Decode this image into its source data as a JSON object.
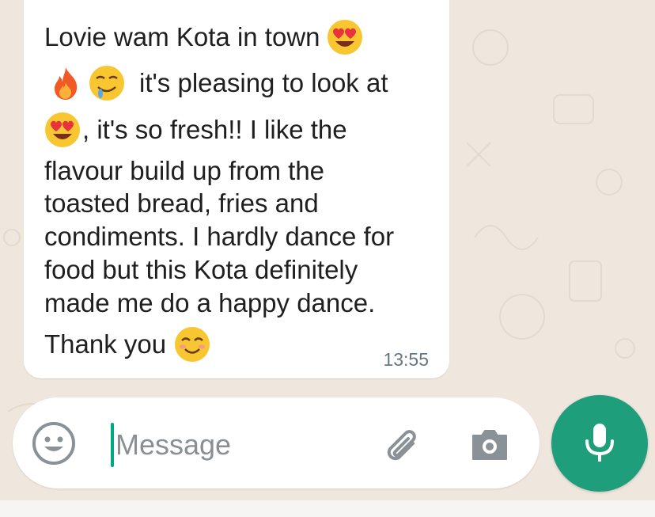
{
  "conversation": {
    "message": {
      "lines": [
        {
          "text_before": "Lovie wam Kota in town",
          "emojis_after": [
            "heart-eyes"
          ]
        },
        {
          "emojis_before": [
            "fire",
            "drooling-face"
          ],
          "text_after": "it's pleasing to look at"
        },
        {
          "emojis_before": [
            "heart-eyes"
          ],
          "text_after": ", it's so fresh!! I like the"
        },
        {
          "text": "flavour build up from the"
        },
        {
          "text": "toasted bread, fries and"
        },
        {
          "text": "condiments. I hardly dance for"
        },
        {
          "text": "food but this Kota definitely"
        },
        {
          "text": "made me do a happy dance."
        },
        {
          "text_before": "Thank you",
          "emojis_after": [
            "smiling-face"
          ]
        }
      ],
      "timestamp": "13:55"
    }
  },
  "composer": {
    "placeholder": "Message",
    "emoji_button_icon": "smiley-icon",
    "attach_button_icon": "paperclip-icon",
    "camera_button_icon": "camera-icon",
    "mic_button_icon": "microphone-icon"
  },
  "colors": {
    "chat_background": "#efe7de",
    "bubble": "#ffffff",
    "accent_green": "#1e9e7b",
    "cursor": "#00a884",
    "timestamp": "#667781",
    "icon_gray": "#8a9297"
  }
}
